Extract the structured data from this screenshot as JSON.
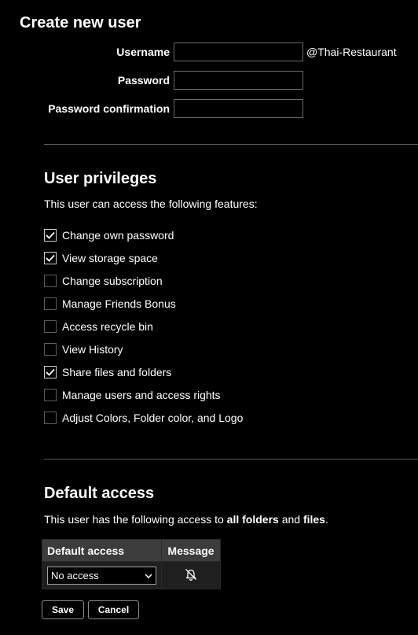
{
  "page_title": "Create new user",
  "form": {
    "username_label": "Username",
    "username_value": "",
    "username_suffix": "@Thai-Restaurant",
    "password_label": "Password",
    "password_value": "",
    "confirm_label": "Password confirmation",
    "confirm_value": ""
  },
  "privileges": {
    "title": "User privileges",
    "description": "This user can access the following features:",
    "items": [
      {
        "label": "Change own password",
        "checked": true
      },
      {
        "label": "View storage space",
        "checked": true
      },
      {
        "label": "Change subscription",
        "checked": false
      },
      {
        "label": "Manage Friends Bonus",
        "checked": false
      },
      {
        "label": "Access recycle bin",
        "checked": false
      },
      {
        "label": "View History",
        "checked": false
      },
      {
        "label": "Share files and folders",
        "checked": true
      },
      {
        "label": "Manage users and access rights",
        "checked": false
      },
      {
        "label": "Adjust Colors, Folder color, and Logo",
        "checked": false
      }
    ]
  },
  "default_access": {
    "title": "Default access",
    "text_prefix": "This user has the following access to ",
    "text_bold1": "all folders",
    "text_and": " and ",
    "text_bold2": "files",
    "text_end": ".",
    "col_access": "Default access",
    "col_message": "Message",
    "access_value": "No access",
    "message_icon": "bell-off-icon"
  },
  "buttons": {
    "save": "Save",
    "cancel": "Cancel"
  }
}
